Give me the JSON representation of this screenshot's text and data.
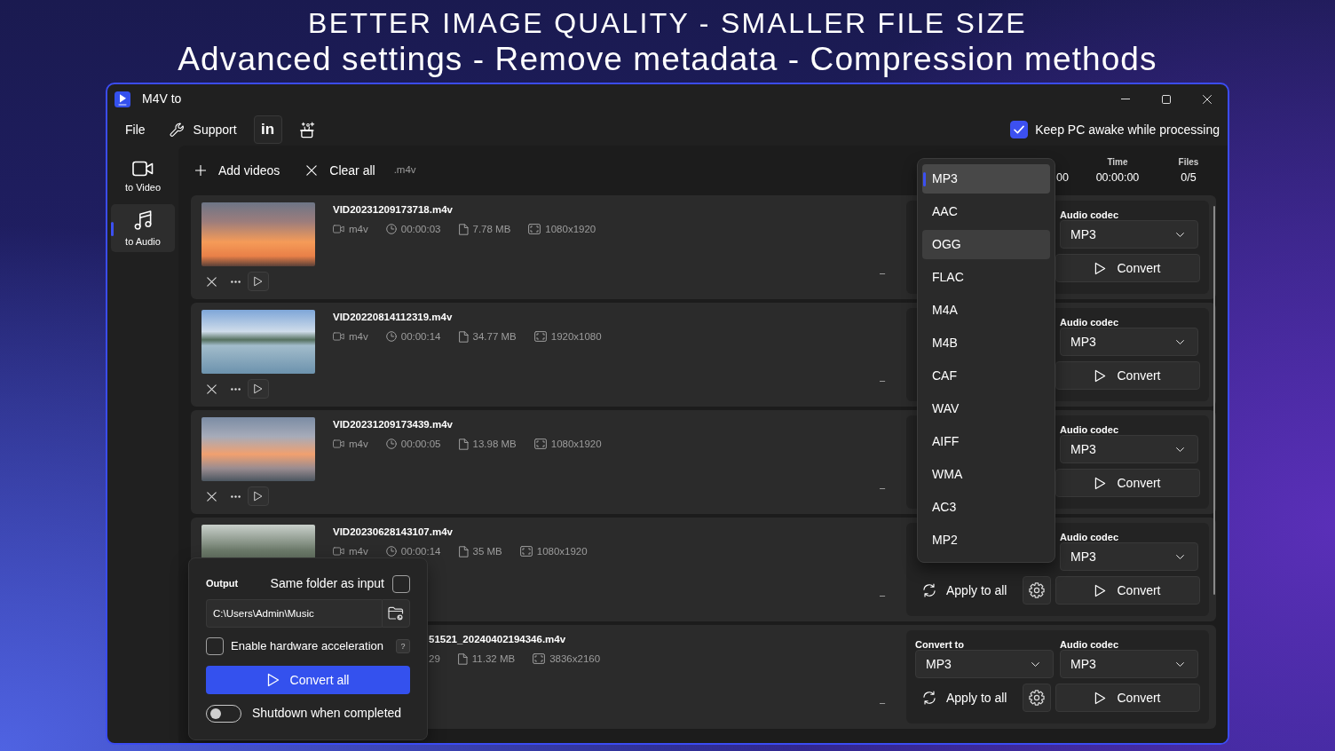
{
  "headline": {
    "title": "BETTER IMAGE QUALITY - SMALLER FILE SIZE",
    "subtitle": "Advanced settings - Remove metadata - Compression methods"
  },
  "window": {
    "title": "M4V to"
  },
  "menu": [
    {
      "kind": "text",
      "label": "File"
    },
    {
      "kind": "tool",
      "label": "Support"
    },
    {
      "kind": "boxed",
      "label": "in"
    },
    {
      "kind": "gift"
    }
  ],
  "keep_awake": {
    "label": "Keep PC awake while processing",
    "checked": true
  },
  "sidebar": [
    {
      "kind": "video",
      "label": "to Video",
      "selected": false
    },
    {
      "kind": "audio",
      "label": "to Audio",
      "selected": true
    }
  ],
  "toolbar": {
    "add": "Add videos",
    "clear": "Clear all",
    "filter": ".m4v"
  },
  "stats": [
    {
      "value": "00"
    },
    {
      "label": "Time",
      "value": "00:00:00"
    },
    {
      "label": "Files",
      "value": "0/5"
    }
  ],
  "files": [
    {
      "kind": "full",
      "name": "VID20231209173718.m4v",
      "meta": [
        {
          "kind": "format",
          "text": "m4v"
        },
        {
          "kind": "duration",
          "text": "00:00:03"
        },
        {
          "kind": "size",
          "text": "7.78 MB"
        },
        {
          "kind": "resolution",
          "text": "1080x1920"
        }
      ],
      "status": "–",
      "codec": {
        "label": "Audio codec",
        "value": "MP3"
      },
      "convert": "Convert"
    },
    {
      "kind": "full",
      "name": "VID20220814112319.m4v",
      "meta": [
        {
          "kind": "format",
          "text": "m4v"
        },
        {
          "kind": "duration",
          "text": "00:00:14"
        },
        {
          "kind": "size",
          "text": "34.77 MB"
        },
        {
          "kind": "resolution",
          "text": "1920x1080"
        }
      ],
      "status": "–",
      "codec": {
        "label": "Audio codec",
        "value": "MP3"
      },
      "convert": "Convert"
    },
    {
      "kind": "full",
      "name": "VID20231209173439.m4v",
      "meta": [
        {
          "kind": "format",
          "text": "m4v"
        },
        {
          "kind": "duration",
          "text": "00:00:05"
        },
        {
          "kind": "size",
          "text": "13.98 MB"
        },
        {
          "kind": "resolution",
          "text": "1080x1920"
        }
      ],
      "status": "–",
      "codec": {
        "label": "Audio codec",
        "value": "MP3"
      },
      "convert": "Convert"
    },
    {
      "kind": "thumbnail_only",
      "name": "VID20230628143107.m4v",
      "meta": [
        {
          "kind": "format",
          "text": "m4v"
        },
        {
          "kind": "duration",
          "text": "00:00:14"
        },
        {
          "kind": "size",
          "text": "35 MB"
        },
        {
          "kind": "resolution",
          "text": "1080x1920"
        }
      ],
      "status": "–",
      "codec": {
        "label": "Audio codec",
        "value": "MP3"
      },
      "apply": "Apply to all",
      "convert": "Convert"
    },
    {
      "kind": "info_only",
      "name": "51521_20240402194346.m4v",
      "meta": [
        {
          "kind": "fragment",
          "text": "29"
        },
        {
          "kind": "size",
          "text": "11.32 MB"
        },
        {
          "kind": "resolution",
          "text": "3836x2160"
        }
      ],
      "status": "–",
      "convert_to": {
        "label": "Convert to",
        "value": "MP3"
      },
      "codec": {
        "label": "Audio codec",
        "value": "MP3"
      },
      "apply": "Apply to all",
      "convert": "Convert"
    }
  ],
  "format_menu": {
    "items": [
      {
        "label": "MP3",
        "selected": true,
        "hovered": false
      },
      {
        "label": "AAC",
        "selected": false,
        "hovered": false
      },
      {
        "label": "OGG",
        "selected": false,
        "hovered": true
      },
      {
        "label": "FLAC",
        "selected": false,
        "hovered": false
      },
      {
        "label": "M4A",
        "selected": false,
        "hovered": false
      },
      {
        "label": "M4B",
        "selected": false,
        "hovered": false
      },
      {
        "label": "CAF",
        "selected": false,
        "hovered": false
      },
      {
        "label": "WAV",
        "selected": false,
        "hovered": false
      },
      {
        "label": "AIFF",
        "selected": false,
        "hovered": false
      },
      {
        "label": "WMA",
        "selected": false,
        "hovered": false
      },
      {
        "label": "AC3",
        "selected": false,
        "hovered": false
      },
      {
        "label": "MP2",
        "selected": false,
        "hovered": false
      }
    ]
  },
  "output": {
    "title": "Output",
    "same_folder": {
      "label": "Same folder as input",
      "checked": false
    },
    "path": "C:\\Users\\Admin\\Music",
    "hw_accel": {
      "label": "Enable hardware acceleration",
      "checked": false
    },
    "help": "?",
    "convert_all": "Convert all",
    "shutdown": {
      "label": "Shutdown when completed",
      "on": false
    }
  }
}
